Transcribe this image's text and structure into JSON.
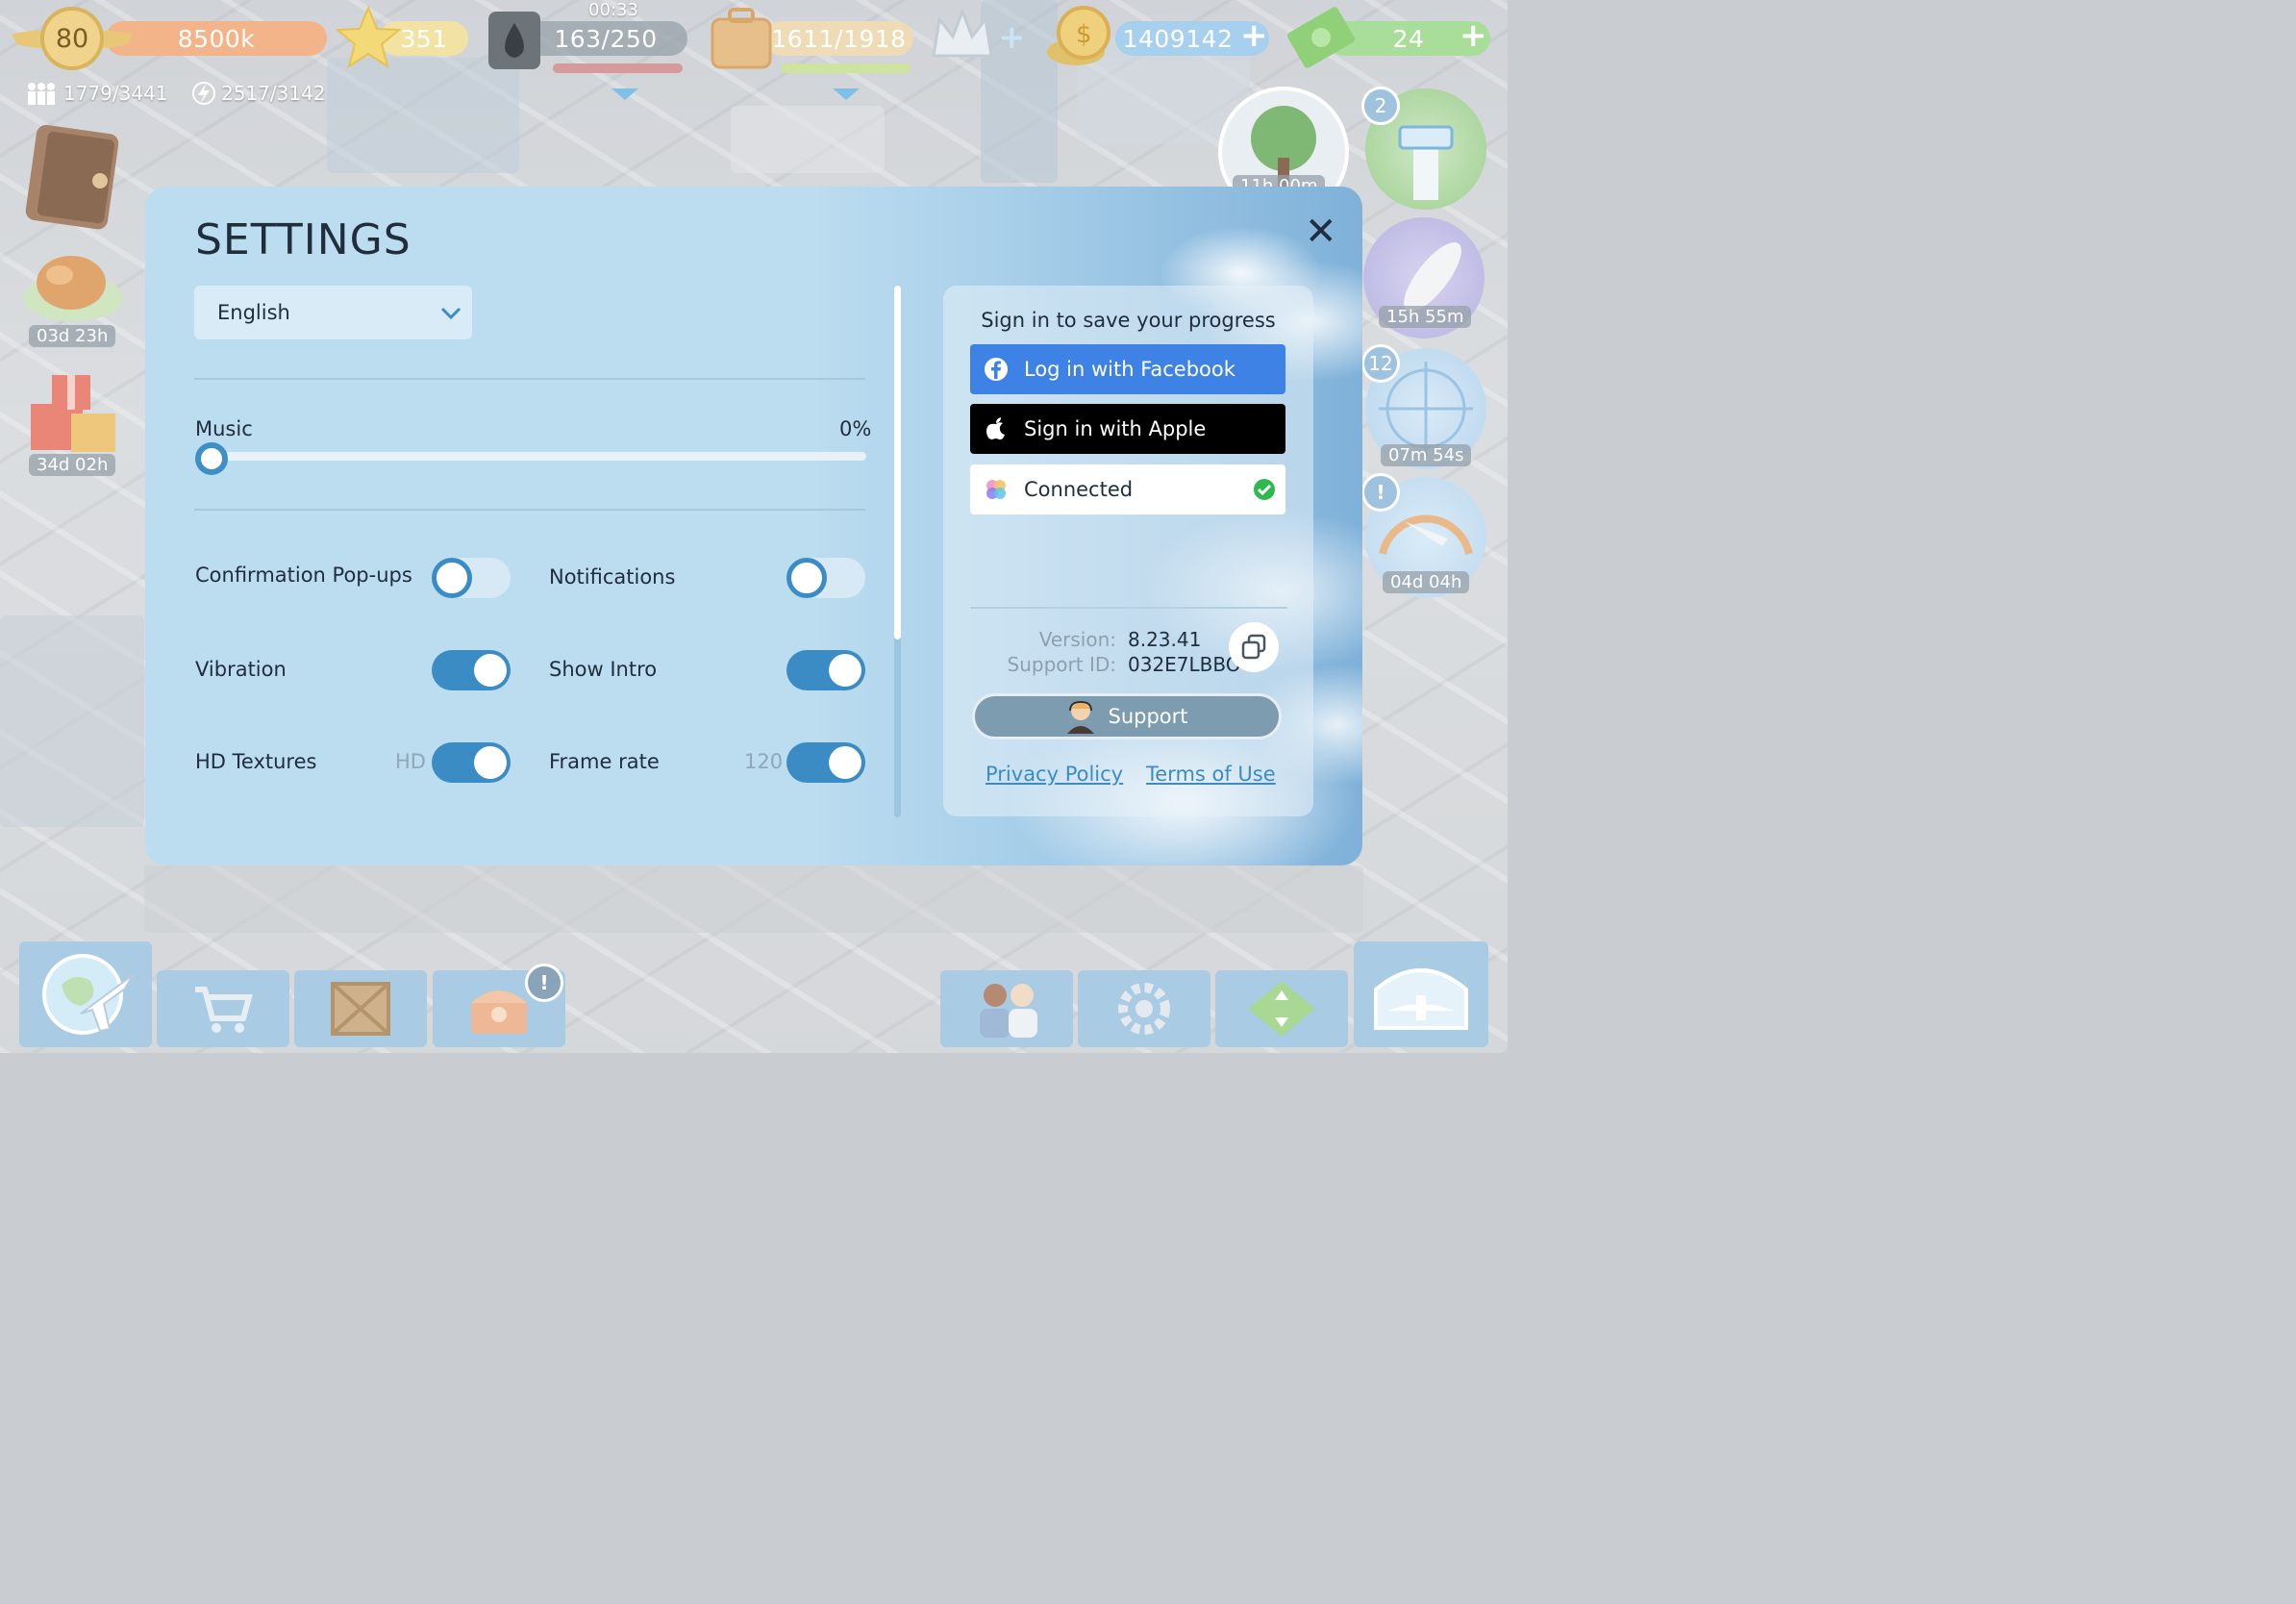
{
  "hud": {
    "level": "80",
    "xp": "8500k",
    "stars": "351",
    "fuel_time": "00:33",
    "fuel": "163/250",
    "cargo": "1611/1918",
    "coins": "1409142",
    "cash": "24",
    "passengers": "1779/3441",
    "energy": "2517/3142"
  },
  "side": {
    "timer_food": "03d 23h",
    "timer_gift": "34d 02h",
    "timer_tree": "11h 00m",
    "tower_badge": "2",
    "timer_rocket": "15h 55m",
    "radar_badge": "12",
    "timer_radar": "07m 54s",
    "alert": "!",
    "timer_gauge": "04d 04h"
  },
  "settings": {
    "title": "SETTINGS",
    "language": "English",
    "music_label": "Music",
    "music_value": "0%",
    "music_level": 0,
    "toggles": {
      "confirmation_label": "Confirmation Pop-ups",
      "confirmation_on": false,
      "notifications_label": "Notifications",
      "notifications_on": false,
      "vibration_label": "Vibration",
      "vibration_on": true,
      "show_intro_label": "Show Intro",
      "show_intro_on": true,
      "hd_label": "HD Textures",
      "hd_value": "HD",
      "hd_on": true,
      "framerate_label": "Frame rate",
      "framerate_value": "120",
      "framerate_on": true
    },
    "account": {
      "sign_in_title": "Sign in to save your progress",
      "facebook": "Log in with Facebook",
      "apple": "Sign in with Apple",
      "game_center": "Connected",
      "version_label": "Version:",
      "version": "8.23.41",
      "support_id_label": "Support ID:",
      "support_id": "032E7LBBO",
      "support": "Support",
      "privacy": "Privacy Policy",
      "terms": "Terms of Use"
    }
  },
  "toolbar": {
    "shop_alert": "!"
  },
  "colors": {
    "accent": "#3b8cc5",
    "facebook": "#3e82e5",
    "panel": "#bcdcef"
  }
}
